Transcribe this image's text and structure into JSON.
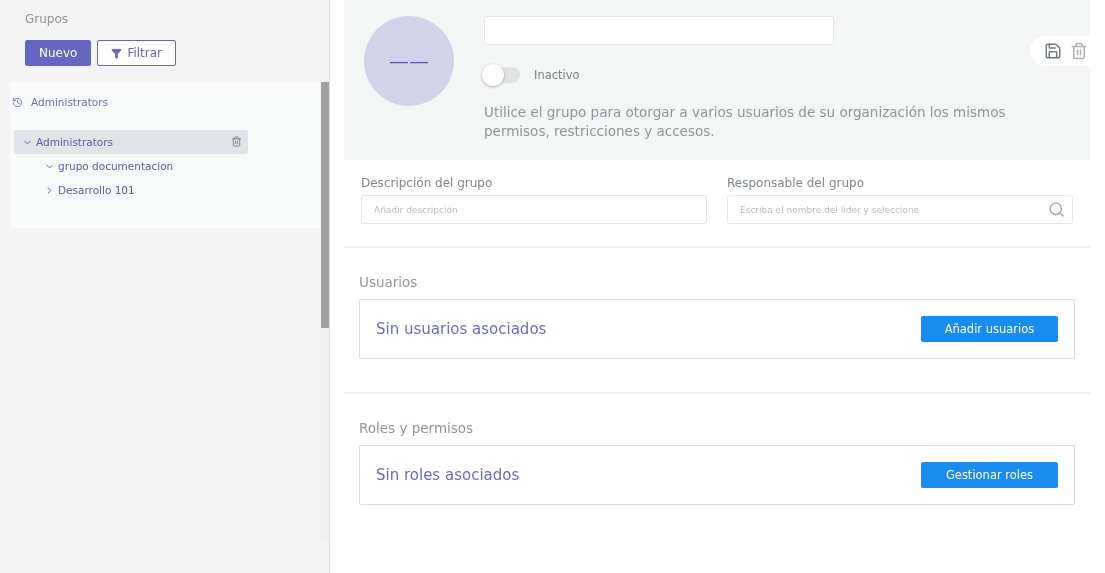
{
  "sidebar": {
    "title": "Grupos",
    "buttons": [
      {
        "label": "Nuevo",
        "kind": "primary"
      },
      {
        "label": "Filtrar",
        "kind": "filter"
      }
    ],
    "root": {
      "label": "Administrators"
    },
    "tree": [
      {
        "label": "Administrators",
        "expanded": true,
        "selected": true,
        "children": [
          {
            "label": "grupo documentacion",
            "expanded": true,
            "selected": false
          },
          {
            "label": "Desarrollo 101",
            "expanded": false,
            "selected": false
          }
        ]
      }
    ]
  },
  "header": {
    "avatar": "——",
    "status": {
      "label": "Inactivo",
      "on": false
    },
    "description": "Utilice el grupo para otorgar a varios usuarios de su organización los mismos permisos, restricciones y accesos."
  },
  "fields": [
    {
      "label": "Descripción del grupo",
      "placeholder": "Añadir descripción",
      "kind": "text"
    },
    {
      "label": "Responsable del grupo",
      "placeholder": "Escriba el nombre del lider y seleccione",
      "kind": "search"
    }
  ],
  "sections": [
    {
      "title": "Usuarios",
      "empty": "Sin usuarios asociados",
      "button": "Añadir usuarios"
    },
    {
      "title": "Roles y permisos",
      "empty": "Sin roles asociados",
      "button": "Gestionar roles"
    }
  ]
}
